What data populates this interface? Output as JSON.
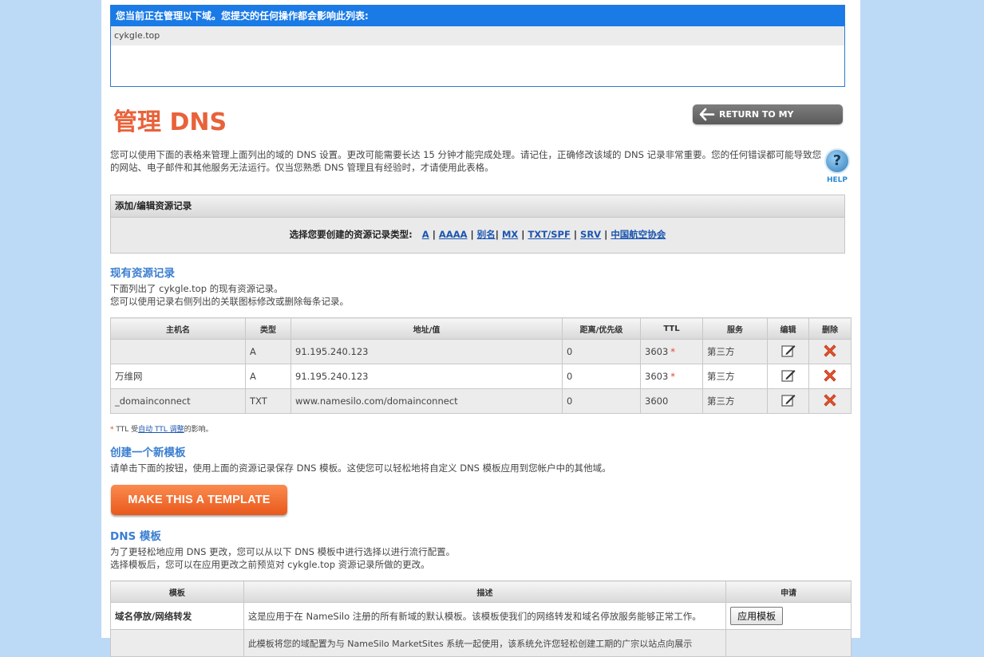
{
  "domain_box": {
    "header": "您当前正在管理以下域。您提交的任何操作都会影响此列表:",
    "domains": [
      "cykgle.top"
    ]
  },
  "page": {
    "title": "管理 DNS",
    "return_label": "RETURN TO MY DOMAINS",
    "intro": "您可以使用下面的表格来管理上面列出的域的 DNS 设置。更改可能需要长达 15 分钟才能完成处理。请记住，正确修改该域的 DNS 记录非常重要。您的任何错误都可能导致您的网站、电子邮件和其他服务无法运行。仅当您熟悉 DNS 管理且有经验时，才请使用此表格。",
    "help_label": "HELP",
    "help_glyph": "?"
  },
  "add_edit": {
    "header": "添加/编辑资源记录",
    "prompt": "选择您要创建的资源记录类型:",
    "types": [
      "A",
      "AAAA",
      "别名",
      "MX",
      "TXT/SPF",
      "SRV",
      "中国航空协会"
    ]
  },
  "existing": {
    "title": "现有资源记录",
    "text_line1": "下面列出了 cykgle.top 的现有资源记录。",
    "text_line2": "您可以使用记录右侧列出的关联图标修改或删除每条记录。",
    "columns": [
      "主机名",
      "类型",
      "地址/值",
      "距离/优先级",
      "TTL",
      "服务",
      "编辑",
      "删除"
    ],
    "rows": [
      {
        "host": "",
        "type": "A",
        "value": "91.195.240.123",
        "priority": "0",
        "ttl": "3603",
        "star": "*",
        "service": "第三方"
      },
      {
        "host": "万维网",
        "type": "A",
        "value": "91.195.240.123",
        "priority": "0",
        "ttl": "3603",
        "star": "*",
        "service": "第三方"
      },
      {
        "host": "_domainconnect",
        "type": "TXT",
        "value": "www.namesilo.com/domainconnect",
        "priority": "0",
        "ttl": "3600",
        "star": "",
        "service": "第三方"
      }
    ],
    "note_star": "*",
    "note_pre": " TTL 受",
    "note_link": "自动 TTL 调整",
    "note_post": "的影响。"
  },
  "new_template": {
    "title": "创建一个新模板",
    "text": "请单击下面的按钮，使用上面的资源记录保存 DNS 模板。这使您可以轻松地将自定义 DNS 模板应用到您帐户中的其他域。",
    "button": "MAKE THIS A TEMPLATE"
  },
  "dns_templates": {
    "title": "DNS 模板",
    "text_line1": "为了更轻松地应用 DNS 更改，您可以从以下 DNS 模板中进行选择以进行流行配置。",
    "text_line2": "选择模板后，您可以在应用更改之前预览对 cykgle.top 资源记录所做的更改。",
    "columns": [
      "模板",
      "描述",
      "申请"
    ],
    "rows": [
      {
        "name": "域名停放/网络转发",
        "desc": "这是应用于在 NameSilo 注册的所有新域的默认模板。该模板使我们的网络转发和域名停放服务能够正常工作。",
        "button": "应用模板"
      },
      {
        "name": "",
        "desc": "此模板将您的域配置为与 NameSilo MarketSites 系统一起使用，该系统允许您轻松创建工期的广宗以站点向展示",
        "button": ""
      }
    ]
  },
  "colors": {
    "background": "#bcd9f5",
    "header_blue": "#1a7ae6",
    "title_orange": "#e8623a",
    "section_blue": "#3a7ed0",
    "delete_red": "#e4532b"
  }
}
